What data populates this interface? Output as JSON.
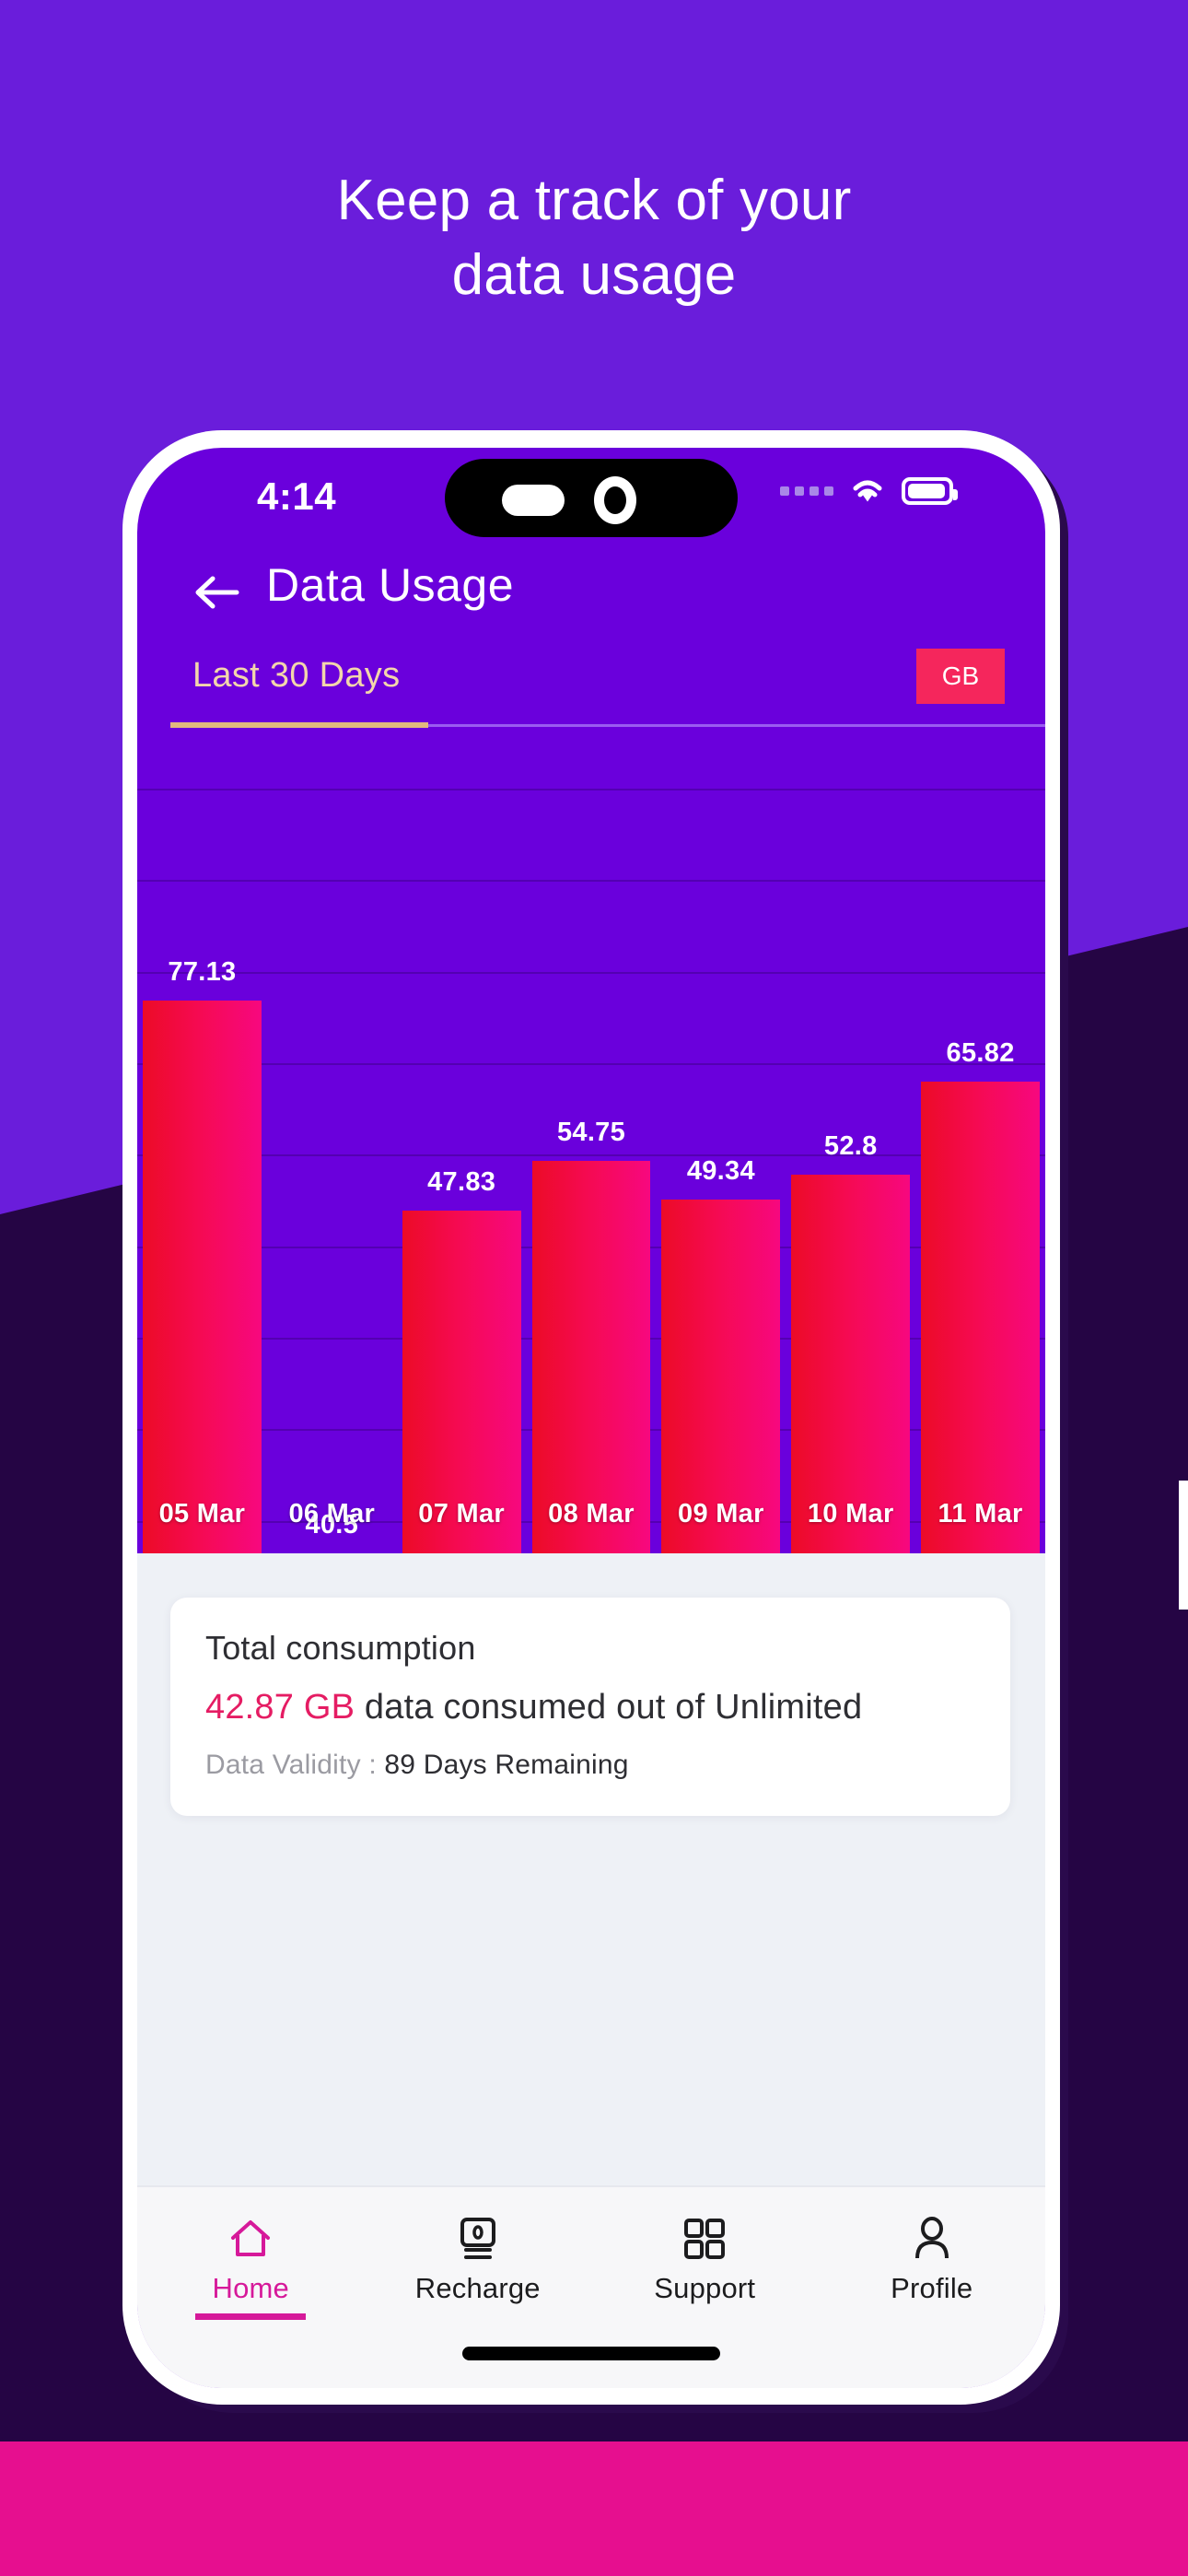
{
  "headline": {
    "line1": "Keep a track of your",
    "line2": "data usage"
  },
  "colors": {
    "bg_purple": "#6a1ddb",
    "bg_dark_purple": "#250544",
    "bg_magenta": "#e60f8f",
    "screen_purple": "#6a00dc",
    "bar_start": "#ec0b27",
    "bar_end": "#f7087f",
    "accent_pink": "#e51c63",
    "nav_active": "#d6199a",
    "badge_pink": "#f5265c",
    "tab_cream": "#f3d6ab"
  },
  "status_bar": {
    "time": "4:14",
    "signal_icon": "signal-dots-icon",
    "wifi_icon": "wifi-icon",
    "battery_icon": "battery-icon"
  },
  "app_header": {
    "back_icon": "back-arrow-icon",
    "title": "Data Usage"
  },
  "tabs": {
    "active_tab": "Last 30 Days",
    "unit_badge": "GB"
  },
  "chart_data": {
    "type": "bar",
    "title": "Data Usage",
    "categories": [
      "05 Mar",
      "06 Mar",
      "07 Mar",
      "08 Mar",
      "09 Mar",
      "10 Mar",
      "11 Mar"
    ],
    "values": [
      77.13,
      40.5,
      47.83,
      54.75,
      49.34,
      52.8,
      65.82
    ],
    "value_labels": [
      "77.13",
      "40.5",
      "47.83",
      "54.75",
      "49.34",
      "52.8",
      "65.82"
    ],
    "xlabel": "",
    "ylabel": "",
    "unit": "GB",
    "ylim": [
      0,
      90
    ],
    "grid": true,
    "legend": "none"
  },
  "info_card": {
    "title": "Total consumption",
    "amount": "42.87 GB",
    "amount_suffix": " data consumed out of Unlimited",
    "validity_label": "Data Validity : ",
    "validity_value": "89 Days Remaining"
  },
  "bottom_nav": {
    "items": [
      {
        "label": "Home",
        "icon": "home-icon",
        "active": true
      },
      {
        "label": "Recharge",
        "icon": "recharge-icon",
        "active": false
      },
      {
        "label": "Support",
        "icon": "grid-apps-icon",
        "active": false
      },
      {
        "label": "Profile",
        "icon": "person-icon",
        "active": false
      }
    ]
  }
}
